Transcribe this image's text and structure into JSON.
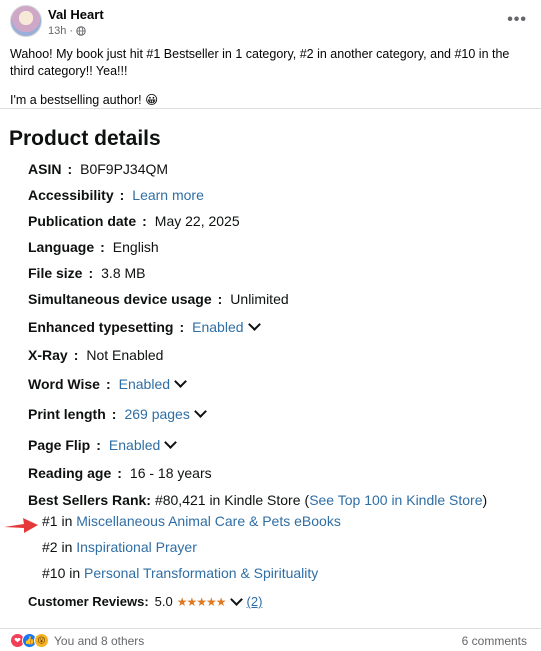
{
  "post": {
    "author": "Val Heart",
    "time": "13h",
    "privacy_icon": "globe-icon",
    "more_icon": "more-dots-icon",
    "more_label": "•••",
    "text_line1": "Wahoo! My book just hit #1 Bestseller in 1 category, #2 in another category, and #10 in the third category!! Yea!!!",
    "text_line2": "I'm a bestselling author! 😀"
  },
  "product": {
    "title": "Product details",
    "rows": {
      "asin": {
        "label": "ASIN",
        "value": "B0F9PJ34QM"
      },
      "accessibility": {
        "label": "Accessibility",
        "value": "Learn more"
      },
      "publication": {
        "label": "Publication date",
        "value": "May 22, 2025"
      },
      "language": {
        "label": "Language",
        "value": "English"
      },
      "filesize": {
        "label": "File size",
        "value": "3.8 MB"
      },
      "simultaneous": {
        "label": "Simultaneous device usage",
        "value": "Unlimited"
      },
      "typesetting": {
        "label": "Enhanced typesetting",
        "value": "Enabled"
      },
      "xray": {
        "label": "X-Ray",
        "value": "Not Enabled"
      },
      "wordwise": {
        "label": "Word Wise",
        "value": "Enabled"
      },
      "printlength": {
        "label": "Print length",
        "value": "269 pages"
      },
      "pageflip": {
        "label": "Page Flip",
        "value": "Enabled"
      },
      "readingage": {
        "label": "Reading age",
        "value": "16 - 18 years"
      }
    },
    "bestsellers": {
      "label": "Best Sellers Rank:",
      "value": "#80,421 in Kindle Store",
      "open_paren": "(",
      "top100_link": "See Top 100 in Kindle Store",
      "close_paren": ")",
      "ranks": [
        {
          "rank": "#1 in",
          "category": "Miscellaneous Animal Care & Pets eBooks"
        },
        {
          "rank": "#2 in",
          "category": "Inspirational Prayer"
        },
        {
          "rank": "#10 in",
          "category": "Personal Transformation & Spirituality"
        }
      ]
    },
    "reviews": {
      "label": "Customer Reviews:",
      "rating": "5.0",
      "stars": "★★★★★",
      "count": "(2)"
    }
  },
  "footer": {
    "reactions_text": "You and 8 others",
    "comments": "6 comments"
  },
  "colors": {
    "link": "#2f6ea5",
    "star": "#de7921",
    "arrow": "#e63a3a"
  }
}
